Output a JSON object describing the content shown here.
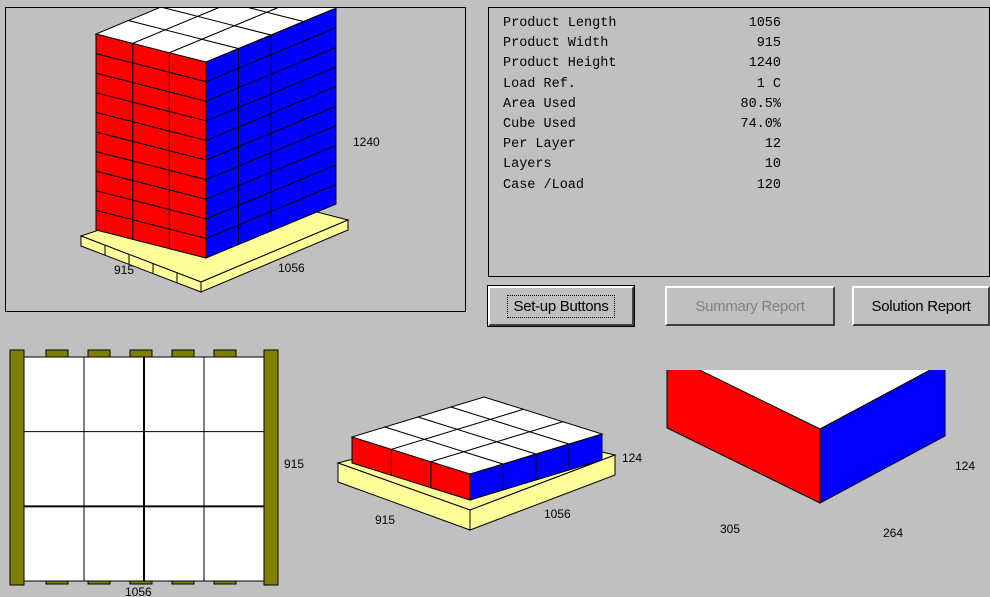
{
  "product_info": {
    "rows": [
      {
        "label": "Product Length",
        "value": "1056"
      },
      {
        "label": "Product Width",
        "value": "915"
      },
      {
        "label": "Product Height",
        "value": "1240"
      },
      {
        "label": "Load Ref.",
        "value": "1 C"
      },
      {
        "label": "Area Used",
        "value": "80.5%"
      },
      {
        "label": "Cube Used",
        "value": "74.0%"
      },
      {
        "label": "Per Layer",
        "value": "12"
      },
      {
        "label": "Layers",
        "value": "10"
      },
      {
        "label": "Case /Load",
        "value": "120"
      }
    ]
  },
  "buttons": {
    "setup": "Set-up Buttons",
    "summary": "Summary Report",
    "solution": "Solution Report"
  },
  "iso_view": {
    "width_label": "915",
    "length_label": "1056",
    "height_label": "1240"
  },
  "top_view": {
    "width_label": "915",
    "length_label": "1056"
  },
  "layer_view": {
    "width_label": "915",
    "length_label": "1056",
    "height_label": "124"
  },
  "case_view": {
    "width_label": "305",
    "length_label": "264",
    "height_label": "124"
  },
  "colors": {
    "side_a": "#ff0000",
    "side_b": "#0000ff",
    "top": "#ffffff",
    "pallet": "#ffff99",
    "pallet_edge": "#808000"
  }
}
